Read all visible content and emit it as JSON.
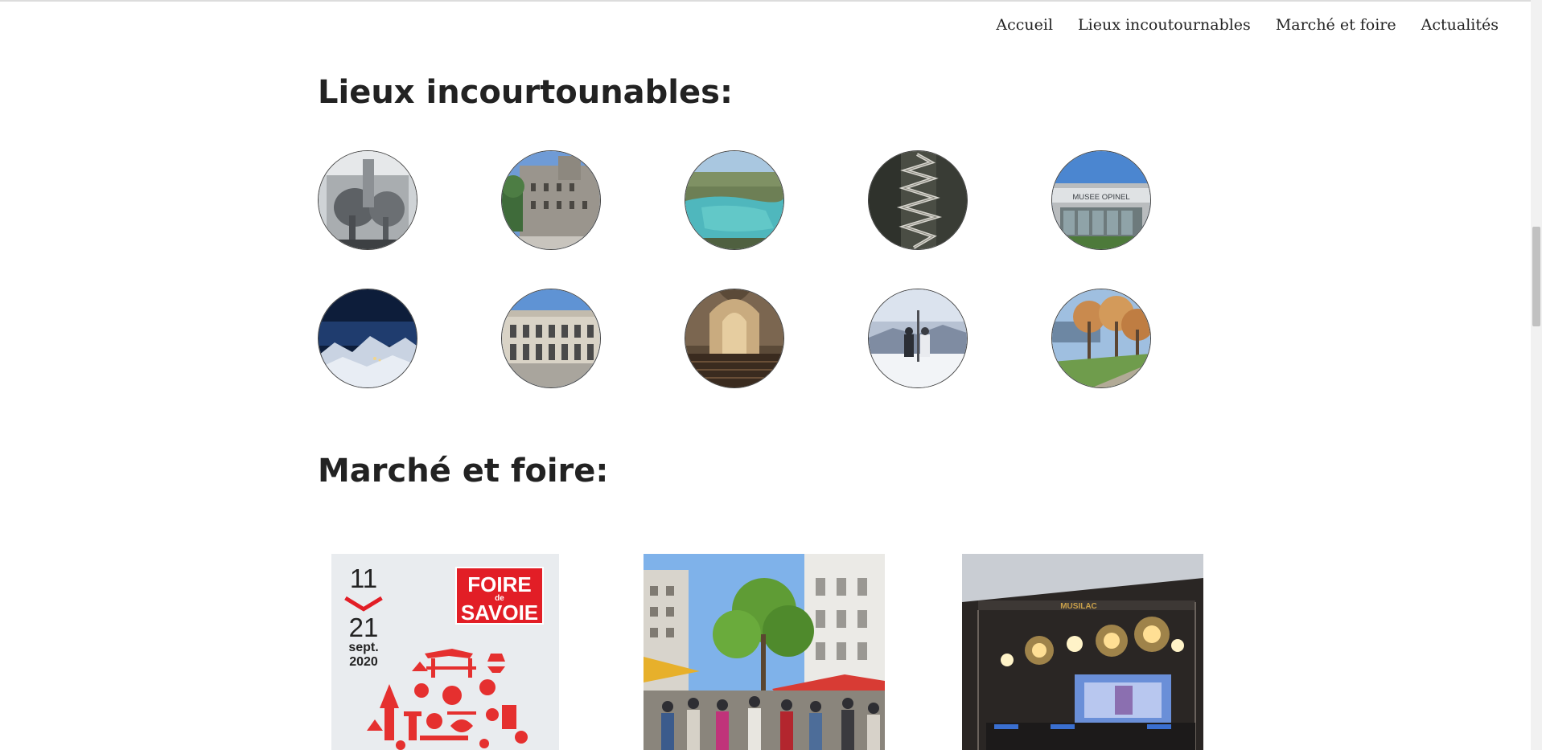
{
  "nav": {
    "items": [
      "Accueil",
      "Lieux incoutournables",
      "Marché et foire",
      "Actualités"
    ]
  },
  "sections": {
    "lieux_title": "Lieux incourtounables:",
    "marche_title": "Marché et foire:"
  },
  "places": [
    {
      "icon": "elephant-fountain-photo"
    },
    {
      "icon": "castle-photo"
    },
    {
      "icon": "lake-photo"
    },
    {
      "icon": "mountain-road-photo"
    },
    {
      "icon": "opinel-museum-photo"
    },
    {
      "icon": "snowy-mountains-night-photo"
    },
    {
      "icon": "theatre-square-photo"
    },
    {
      "icon": "cathedral-interior-photo"
    },
    {
      "icon": "snowy-viewpoint-photo"
    },
    {
      "icon": "lakeside-promenade-photo"
    }
  ],
  "foire": {
    "start": "11",
    "end": "21",
    "month": "sept.",
    "year": "2020",
    "badge_line1": "FOIRE",
    "badge_de": "de",
    "badge_line2": "SAVOIE"
  },
  "museum_sign": "MUSEE OPINEL",
  "concert_sign": "MUSILAC",
  "colors": {
    "text": "#222222",
    "foire_red": "#e21e26",
    "foire_bg": "#e9ecef"
  }
}
